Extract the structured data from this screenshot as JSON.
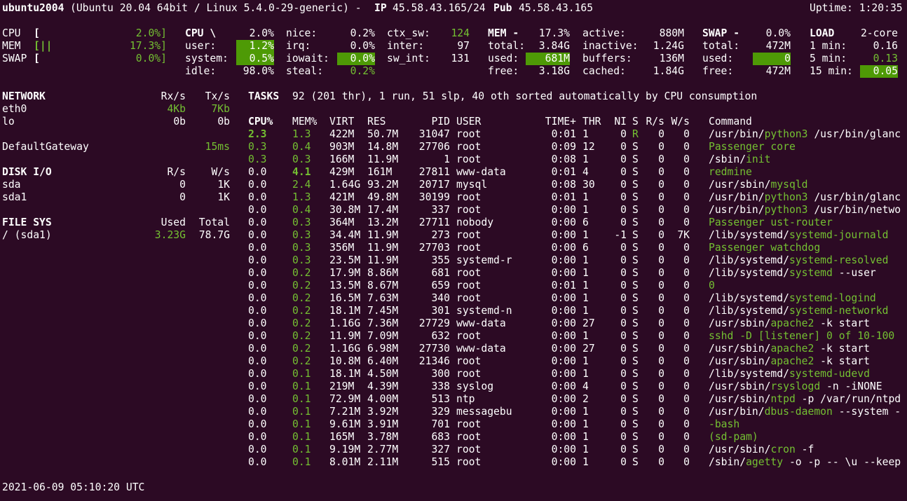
{
  "header": {
    "hostname": "ubuntu2004",
    "system": "(Ubuntu 20.04 64bit / Linux 5.4.0-29-generic) - ",
    "ip_label": "IP",
    "ip_value": "45.58.43.165/24",
    "pub_label": "Pub",
    "pub_value": "45.58.43.165",
    "uptime": "Uptime: 1:20:35"
  },
  "quicklook": {
    "cpu": {
      "label": "CPU",
      "bar": "[",
      "pct": "2.0%]"
    },
    "mem": {
      "label": "MEM",
      "bar": "[||",
      "pct": "17.3%]"
    },
    "swap": {
      "label": "SWAP",
      "bar": "[",
      "pct": "0.0%]"
    }
  },
  "cpu": {
    "title": "CPU \\",
    "total": "2.0%",
    "user_l": "user:",
    "user": "1.2%",
    "system_l": "system:",
    "system": "0.5%",
    "idle_l": "idle:",
    "idle": "98.0%",
    "nice_l": "nice:",
    "nice": "0.2%",
    "irq_l": "irq:",
    "irq": "0.0%",
    "iowait_l": "iowait:",
    "iowait": "0.0%",
    "steal_l": "steal:",
    "steal": "0.2%",
    "ctx_l": "ctx_sw:",
    "ctx": "124",
    "inter_l": "inter:",
    "inter": "97",
    "swint_l": "sw_int:",
    "swint": "131"
  },
  "mem": {
    "title": "MEM -",
    "pct": "17.3%",
    "total_l": "total:",
    "total": "3.84G",
    "used_l": "used:",
    "used": "681M",
    "free_l": "free:",
    "free": "3.18G",
    "active_l": "active:",
    "active": "880M",
    "inactive_l": "inactive:",
    "inactive": "1.24G",
    "buffers_l": "buffers:",
    "buffers": "136M",
    "cached_l": "cached:",
    "cached": "1.84G"
  },
  "swap": {
    "title": "SWAP -",
    "pct": "0.0%",
    "total_l": "total:",
    "total": "472M",
    "used_l": "used:",
    "used": "0",
    "free_l": "free:",
    "free": "472M"
  },
  "load": {
    "title": "LOAD",
    "cores": "2-core",
    "m1_l": "1 min:",
    "m1": "0.16",
    "m5_l": "5 min:",
    "m5": "0.13",
    "m15_l": "15 min:",
    "m15": "0.05"
  },
  "network": {
    "title": "NETWORK",
    "rx_h": "Rx/s",
    "tx_h": "Tx/s",
    "rows": [
      {
        "name": "eth0",
        "rx": "4Kb",
        "tx": "7Kb"
      },
      {
        "name": "lo",
        "rx": "0b",
        "tx": "0b"
      }
    ],
    "gw_label": "DefaultGateway",
    "gw_value": "15ms"
  },
  "disk": {
    "title": "DISK I/O",
    "r_h": "R/s",
    "w_h": "W/s",
    "rows": [
      {
        "name": "sda",
        "r": "0",
        "w": "1K"
      },
      {
        "name": "sda1",
        "r": "0",
        "w": "1K"
      }
    ]
  },
  "fs": {
    "title": "FILE SYS",
    "used_h": "Used",
    "total_h": "Total",
    "rows": [
      {
        "name": "/ (sda1)",
        "used": "3.23G",
        "total": "78.7G"
      }
    ]
  },
  "tasks": {
    "title": "TASKS",
    "summary": "92 (201 thr), 1 run, 51 slp, 40 oth sorted automatically by CPU consumption"
  },
  "proc_headers": [
    "CPU%",
    "MEM%",
    "VIRT",
    "RES",
    "PID",
    "USER",
    "TIME+",
    "THR",
    "NI",
    "S",
    "R/s",
    "W/s",
    "Command"
  ],
  "processes": [
    {
      "cpu": "2.3",
      "mem": "1.3",
      "virt": "422M",
      "res": "50.7M",
      "pid": "31047",
      "user": "root",
      "time": "0:01",
      "thr": "1",
      "ni": "0",
      "s": "R",
      "rs": "0",
      "ws": "0",
      "cmd": [
        {
          "t": "/usr/bin/",
          "c": ""
        },
        {
          "t": "python3",
          "c": "g"
        },
        {
          "t": " /usr/bin/glanc",
          "c": ""
        }
      ],
      "cpuc": "gb",
      "memc": "g",
      "sc": "g"
    },
    {
      "cpu": "0.3",
      "mem": "0.4",
      "virt": "903M",
      "res": "14.8M",
      "pid": "27706",
      "user": "root",
      "time": "0:09",
      "thr": "12",
      "ni": "0",
      "s": "S",
      "rs": "0",
      "ws": "0",
      "cmd": [
        {
          "t": "Passenger core",
          "c": "g"
        }
      ],
      "cpuc": "g",
      "memc": "g",
      "sc": ""
    },
    {
      "cpu": "0.3",
      "mem": "0.3",
      "virt": "166M",
      "res": "11.9M",
      "pid": "1",
      "user": "root",
      "time": "0:08",
      "thr": "1",
      "ni": "0",
      "s": "S",
      "rs": "0",
      "ws": "0",
      "cmd": [
        {
          "t": "/sbin/",
          "c": ""
        },
        {
          "t": "init",
          "c": "g"
        }
      ],
      "cpuc": "g",
      "memc": "g",
      "sc": ""
    },
    {
      "cpu": "0.0",
      "mem": "4.1",
      "virt": "429M",
      "res": "161M",
      "pid": "27811",
      "user": "www-data",
      "time": "0:01",
      "thr": "4",
      "ni": "0",
      "s": "S",
      "rs": "0",
      "ws": "0",
      "cmd": [
        {
          "t": "redmine",
          "c": "g"
        }
      ],
      "cpuc": "",
      "memc": "gb",
      "sc": ""
    },
    {
      "cpu": "0.0",
      "mem": "2.4",
      "virt": "1.64G",
      "res": "93.2M",
      "pid": "20717",
      "user": "mysql",
      "time": "0:08",
      "thr": "30",
      "ni": "0",
      "s": "S",
      "rs": "0",
      "ws": "0",
      "cmd": [
        {
          "t": "/usr/sbin/",
          "c": ""
        },
        {
          "t": "mysqld",
          "c": "g"
        }
      ],
      "cpuc": "",
      "memc": "g",
      "sc": ""
    },
    {
      "cpu": "0.0",
      "mem": "1.3",
      "virt": "421M",
      "res": "49.8M",
      "pid": "30199",
      "user": "root",
      "time": "0:01",
      "thr": "1",
      "ni": "0",
      "s": "S",
      "rs": "0",
      "ws": "0",
      "cmd": [
        {
          "t": "/usr/bin/",
          "c": ""
        },
        {
          "t": "python3",
          "c": "g"
        },
        {
          "t": " /usr/bin/glanc",
          "c": ""
        }
      ],
      "cpuc": "",
      "memc": "g",
      "sc": ""
    },
    {
      "cpu": "0.0",
      "mem": "0.4",
      "virt": "30.8M",
      "res": "17.4M",
      "pid": "337",
      "user": "root",
      "time": "0:00",
      "thr": "1",
      "ni": "0",
      "s": "S",
      "rs": "0",
      "ws": "0",
      "cmd": [
        {
          "t": "/usr/bin/",
          "c": ""
        },
        {
          "t": "python3",
          "c": "g"
        },
        {
          "t": " /usr/bin/netwo",
          "c": ""
        }
      ],
      "cpuc": "",
      "memc": "g",
      "sc": ""
    },
    {
      "cpu": "0.0",
      "mem": "0.3",
      "virt": "364M",
      "res": "13.2M",
      "pid": "27711",
      "user": "nobody",
      "time": "0:00",
      "thr": "6",
      "ni": "0",
      "s": "S",
      "rs": "0",
      "ws": "0",
      "cmd": [
        {
          "t": "Passenger ust-router",
          "c": "g"
        }
      ],
      "cpuc": "",
      "memc": "g",
      "sc": ""
    },
    {
      "cpu": "0.0",
      "mem": "0.3",
      "virt": "34.4M",
      "res": "11.9M",
      "pid": "273",
      "user": "root",
      "time": "0:00",
      "thr": "1",
      "ni": "-1",
      "s": "S",
      "rs": "0",
      "ws": "7K",
      "cmd": [
        {
          "t": "/lib/systemd/",
          "c": ""
        },
        {
          "t": "systemd-journald",
          "c": "g"
        }
      ],
      "cpuc": "",
      "memc": "g",
      "sc": ""
    },
    {
      "cpu": "0.0",
      "mem": "0.3",
      "virt": "356M",
      "res": "11.9M",
      "pid": "27703",
      "user": "root",
      "time": "0:00",
      "thr": "6",
      "ni": "0",
      "s": "S",
      "rs": "0",
      "ws": "0",
      "cmd": [
        {
          "t": "Passenger watchdog",
          "c": "g"
        }
      ],
      "cpuc": "",
      "memc": "g",
      "sc": ""
    },
    {
      "cpu": "0.0",
      "mem": "0.3",
      "virt": "23.5M",
      "res": "11.9M",
      "pid": "355",
      "user": "systemd-r",
      "time": "0:00",
      "thr": "1",
      "ni": "0",
      "s": "S",
      "rs": "0",
      "ws": "0",
      "cmd": [
        {
          "t": "/lib/systemd/",
          "c": ""
        },
        {
          "t": "systemd-resolved",
          "c": "g"
        }
      ],
      "cpuc": "",
      "memc": "g",
      "sc": ""
    },
    {
      "cpu": "0.0",
      "mem": "0.2",
      "virt": "17.9M",
      "res": "8.86M",
      "pid": "681",
      "user": "root",
      "time": "0:00",
      "thr": "1",
      "ni": "0",
      "s": "S",
      "rs": "0",
      "ws": "0",
      "cmd": [
        {
          "t": "/lib/systemd/",
          "c": ""
        },
        {
          "t": "systemd",
          "c": "g"
        },
        {
          "t": " --user",
          "c": ""
        }
      ],
      "cpuc": "",
      "memc": "g",
      "sc": ""
    },
    {
      "cpu": "0.0",
      "mem": "0.2",
      "virt": "13.5M",
      "res": "8.67M",
      "pid": "659",
      "user": "root",
      "time": "0:01",
      "thr": "1",
      "ni": "0",
      "s": "S",
      "rs": "0",
      "ws": "0",
      "cmd": [
        {
          "t": "0",
          "c": "g"
        }
      ],
      "cpuc": "",
      "memc": "g",
      "sc": ""
    },
    {
      "cpu": "0.0",
      "mem": "0.2",
      "virt": "16.5M",
      "res": "7.63M",
      "pid": "340",
      "user": "root",
      "time": "0:00",
      "thr": "1",
      "ni": "0",
      "s": "S",
      "rs": "0",
      "ws": "0",
      "cmd": [
        {
          "t": "/lib/systemd/",
          "c": ""
        },
        {
          "t": "systemd-logind",
          "c": "g"
        }
      ],
      "cpuc": "",
      "memc": "g",
      "sc": ""
    },
    {
      "cpu": "0.0",
      "mem": "0.2",
      "virt": "18.1M",
      "res": "7.45M",
      "pid": "301",
      "user": "systemd-n",
      "time": "0:00",
      "thr": "1",
      "ni": "0",
      "s": "S",
      "rs": "0",
      "ws": "0",
      "cmd": [
        {
          "t": "/lib/systemd/",
          "c": ""
        },
        {
          "t": "systemd-networkd",
          "c": "g"
        }
      ],
      "cpuc": "",
      "memc": "g",
      "sc": ""
    },
    {
      "cpu": "0.0",
      "mem": "0.2",
      "virt": "1.16G",
      "res": "7.36M",
      "pid": "27729",
      "user": "www-data",
      "time": "0:00",
      "thr": "27",
      "ni": "0",
      "s": "S",
      "rs": "0",
      "ws": "0",
      "cmd": [
        {
          "t": "/usr/sbin/",
          "c": ""
        },
        {
          "t": "apache2",
          "c": "g"
        },
        {
          "t": " -k start",
          "c": ""
        }
      ],
      "cpuc": "",
      "memc": "g",
      "sc": ""
    },
    {
      "cpu": "0.0",
      "mem": "0.2",
      "virt": "11.9M",
      "res": "7.09M",
      "pid": "632",
      "user": "root",
      "time": "0:00",
      "thr": "1",
      "ni": "0",
      "s": "S",
      "rs": "0",
      "ws": "0",
      "cmd": [
        {
          "t": "sshd -D [listener] 0 of 10-100",
          "c": "g"
        }
      ],
      "cpuc": "",
      "memc": "g",
      "sc": ""
    },
    {
      "cpu": "0.0",
      "mem": "0.2",
      "virt": "1.16G",
      "res": "6.98M",
      "pid": "27730",
      "user": "www-data",
      "time": "0:00",
      "thr": "27",
      "ni": "0",
      "s": "S",
      "rs": "0",
      "ws": "0",
      "cmd": [
        {
          "t": "/usr/sbin/",
          "c": ""
        },
        {
          "t": "apache2",
          "c": "g"
        },
        {
          "t": " -k start",
          "c": ""
        }
      ],
      "cpuc": "",
      "memc": "g",
      "sc": ""
    },
    {
      "cpu": "0.0",
      "mem": "0.2",
      "virt": "10.8M",
      "res": "6.40M",
      "pid": "21346",
      "user": "root",
      "time": "0:00",
      "thr": "1",
      "ni": "0",
      "s": "S",
      "rs": "0",
      "ws": "0",
      "cmd": [
        {
          "t": "/usr/sbin/",
          "c": ""
        },
        {
          "t": "apache2",
          "c": "g"
        },
        {
          "t": " -k start",
          "c": ""
        }
      ],
      "cpuc": "",
      "memc": "g",
      "sc": ""
    },
    {
      "cpu": "0.0",
      "mem": "0.1",
      "virt": "18.1M",
      "res": "4.50M",
      "pid": "300",
      "user": "root",
      "time": "0:00",
      "thr": "1",
      "ni": "0",
      "s": "S",
      "rs": "0",
      "ws": "0",
      "cmd": [
        {
          "t": "/lib/systemd/",
          "c": ""
        },
        {
          "t": "systemd-udevd",
          "c": "g"
        }
      ],
      "cpuc": "",
      "memc": "g",
      "sc": ""
    },
    {
      "cpu": "0.0",
      "mem": "0.1",
      "virt": "219M",
      "res": "4.39M",
      "pid": "338",
      "user": "syslog",
      "time": "0:00",
      "thr": "4",
      "ni": "0",
      "s": "S",
      "rs": "0",
      "ws": "0",
      "cmd": [
        {
          "t": "/usr/sbin/",
          "c": ""
        },
        {
          "t": "rsyslogd",
          "c": "g"
        },
        {
          "t": " -n -iNONE",
          "c": ""
        }
      ],
      "cpuc": "",
      "memc": "g",
      "sc": ""
    },
    {
      "cpu": "0.0",
      "mem": "0.1",
      "virt": "72.9M",
      "res": "4.00M",
      "pid": "513",
      "user": "ntp",
      "time": "0:00",
      "thr": "2",
      "ni": "0",
      "s": "S",
      "rs": "0",
      "ws": "0",
      "cmd": [
        {
          "t": "/usr/sbin/",
          "c": ""
        },
        {
          "t": "ntpd",
          "c": "g"
        },
        {
          "t": " -p /var/run/ntpd",
          "c": ""
        }
      ],
      "cpuc": "",
      "memc": "g",
      "sc": ""
    },
    {
      "cpu": "0.0",
      "mem": "0.1",
      "virt": "7.21M",
      "res": "3.92M",
      "pid": "329",
      "user": "messagebu",
      "time": "0:00",
      "thr": "1",
      "ni": "0",
      "s": "S",
      "rs": "0",
      "ws": "0",
      "cmd": [
        {
          "t": "/usr/bin/",
          "c": ""
        },
        {
          "t": "dbus-daemon",
          "c": "g"
        },
        {
          "t": " --system -",
          "c": ""
        }
      ],
      "cpuc": "",
      "memc": "g",
      "sc": ""
    },
    {
      "cpu": "0.0",
      "mem": "0.1",
      "virt": "9.61M",
      "res": "3.91M",
      "pid": "701",
      "user": "root",
      "time": "0:00",
      "thr": "1",
      "ni": "0",
      "s": "S",
      "rs": "0",
      "ws": "0",
      "cmd": [
        {
          "t": "-bash",
          "c": "g"
        }
      ],
      "cpuc": "",
      "memc": "g",
      "sc": ""
    },
    {
      "cpu": "0.0",
      "mem": "0.1",
      "virt": "165M",
      "res": "3.78M",
      "pid": "683",
      "user": "root",
      "time": "0:00",
      "thr": "1",
      "ni": "0",
      "s": "S",
      "rs": "0",
      "ws": "0",
      "cmd": [
        {
          "t": "(sd-pam)",
          "c": "g"
        }
      ],
      "cpuc": "",
      "memc": "g",
      "sc": ""
    },
    {
      "cpu": "0.0",
      "mem": "0.1",
      "virt": "9.19M",
      "res": "2.77M",
      "pid": "327",
      "user": "root",
      "time": "0:00",
      "thr": "1",
      "ni": "0",
      "s": "S",
      "rs": "0",
      "ws": "0",
      "cmd": [
        {
          "t": "/usr/sbin/",
          "c": ""
        },
        {
          "t": "cron",
          "c": "g"
        },
        {
          "t": " -f",
          "c": ""
        }
      ],
      "cpuc": "",
      "memc": "g",
      "sc": ""
    },
    {
      "cpu": "0.0",
      "mem": "0.1",
      "virt": "8.01M",
      "res": "2.11M",
      "pid": "515",
      "user": "root",
      "time": "0:00",
      "thr": "1",
      "ni": "0",
      "s": "S",
      "rs": "0",
      "ws": "0",
      "cmd": [
        {
          "t": "/sbin/",
          "c": ""
        },
        {
          "t": "agetty",
          "c": "g"
        },
        {
          "t": " -o -p -- \\u --keep",
          "c": ""
        }
      ],
      "cpuc": "",
      "memc": "g",
      "sc": ""
    }
  ],
  "footer": {
    "timestamp": "2021-06-09 05:10:20 UTC"
  },
  "colors": {
    "background": "#2c0a24",
    "accent_green": "#74c032",
    "highlight_bg": "#4e9a06"
  }
}
